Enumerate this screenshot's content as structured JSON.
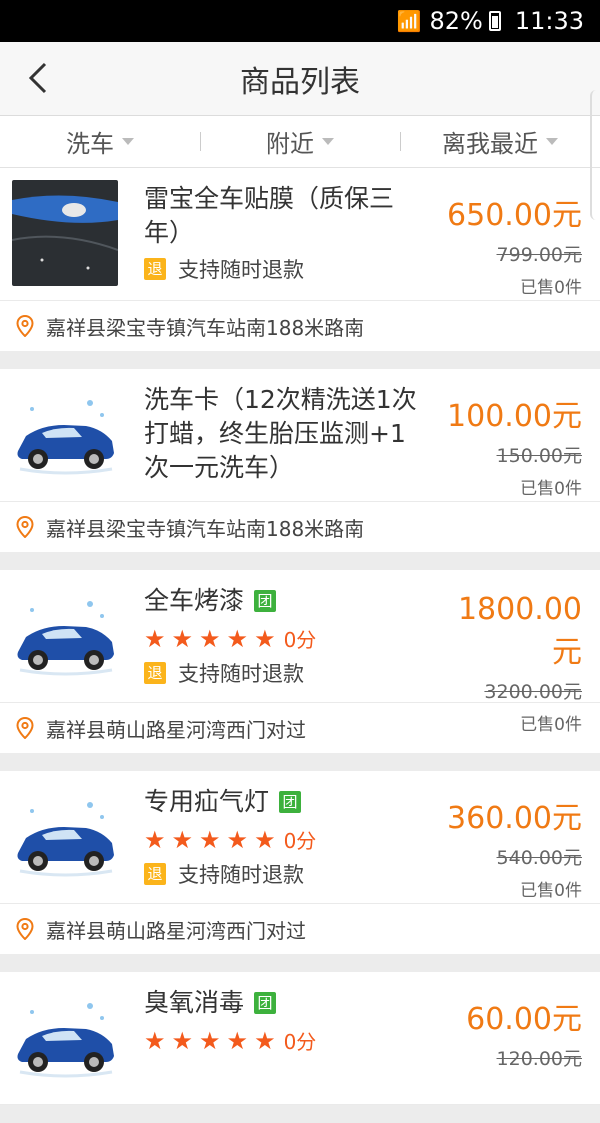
{
  "status": {
    "battery": "82%",
    "time": "11:33"
  },
  "header": {
    "title": "商品列表"
  },
  "filters": [
    "洗车",
    "附近",
    "离我最近"
  ],
  "products": [
    {
      "name": "雷宝全车贴膜（质保三年）",
      "tuan": false,
      "stars": "",
      "score": "",
      "refund_badge": "退",
      "refund": "支持随时退款",
      "price": "650.00元",
      "old_price": "799.00元",
      "sold": "已售0件",
      "address": "嘉祥县梁宝寺镇汽车站南188米路南",
      "thumb": "towel"
    },
    {
      "name": "洗车卡（12次精洗送1次打蜡，终生胎压监测+1次一元洗车）",
      "tuan": false,
      "stars": "",
      "score": "",
      "refund_badge": "",
      "refund": "",
      "price": "100.00元",
      "old_price": "150.00元",
      "sold": "已售0件",
      "address": "嘉祥县梁宝寺镇汽车站南188米路南",
      "thumb": "car"
    },
    {
      "name": "全车烤漆",
      "tuan": true,
      "tuan_label": "团",
      "stars": "★★★★★",
      "score": "0分",
      "refund_badge": "退",
      "refund": "支持随时退款",
      "price": "1800.00元",
      "old_price": "3200.00元",
      "sold": "已售0件",
      "address": "嘉祥县萌山路星河湾西门对过",
      "thumb": "car"
    },
    {
      "name": "专用疝气灯",
      "tuan": true,
      "tuan_label": "团",
      "stars": "★★★★★",
      "score": "0分",
      "refund_badge": "退",
      "refund": "支持随时退款",
      "price": "360.00元",
      "old_price": "540.00元",
      "sold": "已售0件",
      "address": "嘉祥县萌山路星河湾西门对过",
      "thumb": "car"
    },
    {
      "name": "臭氧消毒",
      "tuan": true,
      "tuan_label": "团",
      "stars": "★★★★★",
      "score": "0分",
      "refund_badge": "",
      "refund": "",
      "price": "60.00元",
      "old_price": "120.00元",
      "sold": "",
      "address": "",
      "thumb": "car"
    }
  ],
  "colors": {
    "price": "#f07a14",
    "star": "#f35a1c",
    "tuan": "#3db13d",
    "refund": "#fbb41b"
  }
}
